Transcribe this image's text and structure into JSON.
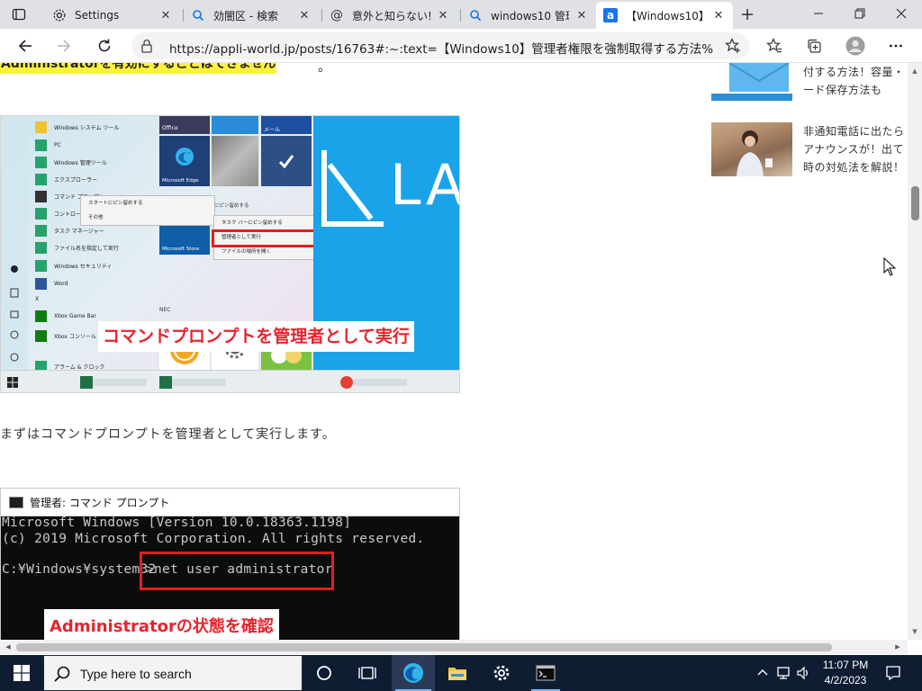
{
  "browser": {
    "tabs": [
      {
        "title": "Settings",
        "icon": "gear-icon"
      },
      {
        "title": "効闇区 - 検索",
        "icon": "search-icon"
      },
      {
        "title": "意外と知らない!?",
        "icon": "at-icon"
      },
      {
        "title": "windows10 管理",
        "icon": "search-icon"
      },
      {
        "title": "【Windows10】管",
        "icon": "site-a-icon"
      }
    ],
    "url": "https://appli-world.jp/posts/16763#:~:text=【Windows10】管理者権限を強制取得する方法%201%..."
  },
  "article": {
    "top_highlight": "Administratorを有効にすることはできません",
    "top_after": "。",
    "shot1": {
      "brand_text": "LA",
      "start_items": [
        "Windows システム ツール",
        "PC",
        "Windows 管理ツール",
        "エクスプローラー",
        "コマンド プロンプト",
        "コントロール パネル",
        "タスク マネージャー",
        "ファイル名を指定して実行",
        "Windows セキュリティ",
        "Word",
        "X",
        "Xbox Game Bar",
        "Xbox コンソール コンパニオン",
        "アラーム & クロック"
      ],
      "tile_labels": [
        "Office",
        "Microsoft Edge",
        "Microsoft Store",
        "NEC",
        "メール"
      ],
      "context_menu_1": [
        "スタートにピン留めする",
        "その他"
      ],
      "context_menu_2": [
        "タスク バーにピン留めする",
        "管理者として実行",
        "ファイルの場所を開く"
      ],
      "partial_label": "にピン留めする",
      "callout": "コマンドプロンプトを管理者として実行"
    },
    "paragraph": "まずはコマンドプロンプトを管理者として実行します。",
    "shot2": {
      "window_title": "管理者: コマンド プロンプト",
      "lines": [
        "Microsoft Windows [Version 10.0.18363.1198]",
        "(c) 2019 Microsoft Corporation. All rights reserved."
      ],
      "prompt": "C:¥Windows¥system32",
      "command": ">net user administrator",
      "callout": "Administratorの状態を確認"
    }
  },
  "sidebar": {
    "item1_lines": [
      "付する方法！容量・",
      "ード保存方法も"
    ],
    "item2_lines": [
      "非通知電話に出たら",
      "アナウンスが！出て",
      "時の対処法を解説！"
    ]
  },
  "taskbar": {
    "search_placeholder": "Type here to search",
    "time": "11:07 PM",
    "date": "4/2/2023"
  },
  "colors": {
    "highlight": "#fdf23b",
    "callout_red": "#e6242f",
    "brand_blue": "#1aa3e8",
    "taskbar": "#0f1d33"
  }
}
